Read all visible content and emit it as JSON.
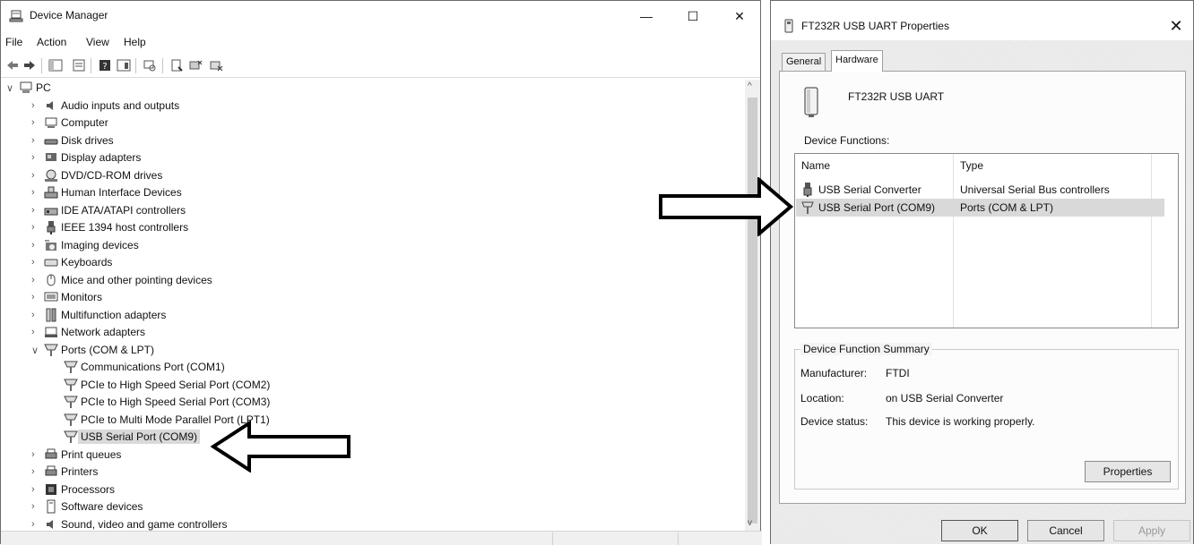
{
  "device_manager": {
    "title": "Device Manager",
    "window_controls": {
      "minimize": "—",
      "maximize": "☐",
      "close": "✕"
    },
    "menu": [
      "File",
      "Action",
      "View",
      "Help"
    ],
    "tree": {
      "root": "PC",
      "items": [
        {
          "label": "Audio inputs and outputs",
          "icon": "speaker-icon",
          "state": "collapsed"
        },
        {
          "label": "Computer",
          "icon": "computer-icon",
          "state": "collapsed"
        },
        {
          "label": "Disk drives",
          "icon": "disk-drive-icon",
          "state": "collapsed"
        },
        {
          "label": "Display adapters",
          "icon": "display-adapter-icon",
          "state": "collapsed"
        },
        {
          "label": "DVD/CD-ROM drives",
          "icon": "dvd-drive-icon",
          "state": "collapsed"
        },
        {
          "label": "Human Interface Devices",
          "icon": "hid-icon",
          "state": "collapsed"
        },
        {
          "label": "IDE ATA/ATAPI controllers",
          "icon": "ide-controller-icon",
          "state": "collapsed"
        },
        {
          "label": "IEEE 1394 host controllers",
          "icon": "ieee1394-icon",
          "state": "collapsed"
        },
        {
          "label": "Imaging devices",
          "icon": "camera-icon",
          "state": "collapsed"
        },
        {
          "label": "Keyboards",
          "icon": "keyboard-icon",
          "state": "collapsed"
        },
        {
          "label": "Mice and other pointing devices",
          "icon": "mouse-icon",
          "state": "collapsed"
        },
        {
          "label": "Monitors",
          "icon": "monitor-icon",
          "state": "collapsed"
        },
        {
          "label": "Multifunction adapters",
          "icon": "multifunction-icon",
          "state": "collapsed"
        },
        {
          "label": "Network adapters",
          "icon": "network-adapter-icon",
          "state": "collapsed"
        },
        {
          "label": "Ports (COM & LPT)",
          "icon": "port-icon",
          "state": "expanded"
        },
        {
          "label": "Communications Port (COM1)",
          "icon": "port-icon",
          "state": "child"
        },
        {
          "label": "PCIe to High Speed Serial Port (COM2)",
          "icon": "port-icon",
          "state": "child"
        },
        {
          "label": "PCIe to High Speed Serial Port (COM3)",
          "icon": "port-icon",
          "state": "child"
        },
        {
          "label": "PCIe to Multi Mode Parallel Port (LPT1)",
          "icon": "port-icon",
          "state": "child"
        },
        {
          "label": "USB Serial Port (COM9)",
          "icon": "port-icon",
          "state": "child-selected"
        },
        {
          "label": "Print queues",
          "icon": "printer-icon",
          "state": "collapsed"
        },
        {
          "label": "Printers",
          "icon": "printer-icon",
          "state": "collapsed"
        },
        {
          "label": "Processors",
          "icon": "processor-icon",
          "state": "collapsed"
        },
        {
          "label": "Software devices",
          "icon": "software-device-icon",
          "state": "collapsed"
        },
        {
          "label": "Sound, video and game controllers",
          "icon": "sound-icon",
          "state": "collapsed"
        }
      ]
    }
  },
  "properties_dialog": {
    "title": "FT232R USB UART Properties",
    "close": "✕",
    "tabs": [
      {
        "label": "General",
        "active": false
      },
      {
        "label": "Hardware",
        "active": true
      }
    ],
    "device_name": "FT232R USB UART",
    "functions_label": "Device Functions:",
    "columns": [
      "Name",
      "Type"
    ],
    "rows": [
      {
        "name": "USB Serial Converter",
        "type": "Universal Serial Bus controllers",
        "icon": "usb-plug-icon",
        "selected": false
      },
      {
        "name": "USB Serial Port (COM9)",
        "type": "Ports (COM & LPT)",
        "icon": "port-icon",
        "selected": true
      }
    ],
    "summary": {
      "title": "Device Function Summary",
      "manufacturer_label": "Manufacturer:",
      "manufacturer": "FTDI",
      "location_label": "Location:",
      "location": "on USB Serial Converter",
      "status_label": "Device status:",
      "status": "This device is working properly."
    },
    "buttons": {
      "properties": "Properties",
      "ok": "OK",
      "cancel": "Cancel",
      "apply": "Apply"
    }
  }
}
